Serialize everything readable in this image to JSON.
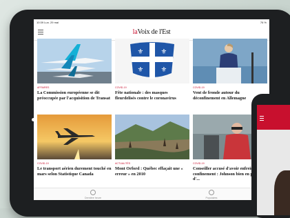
{
  "status": {
    "time": "10:39  Lun. 29 mai",
    "battery": "76 %"
  },
  "header": {
    "logo_la": "la",
    "logo_rest": "Voix de l'Est"
  },
  "articles": [
    {
      "category": "AFFAIRES",
      "title": "La Commission européenne se dit préoccupée par l'acquisition de Transat"
    },
    {
      "category": "COVID-19",
      "title": "Fête nationale : des masques fleurdelisés contre le coronavirus"
    },
    {
      "category": "COVID-19",
      "title": "Vent de fronde autour du déconfinement en Allemagne"
    },
    {
      "category": "COVID-19",
      "title": "Le transport aérien durement touché en mars selon Statistique Canada"
    },
    {
      "category": "ACTUALITÉS",
      "title": "Mont Orford : Québec effaçait une « erreur » en 2010"
    },
    {
      "category": "COVID-19",
      "title": "Conseiller accusé d'avoir enfreint le confinement : Johnson bien en peine d'..."
    }
  ],
  "bottom_tabs": [
    {
      "label": "Dernière heure"
    },
    {
      "label": "Populaires"
    }
  ],
  "colors": {
    "brand": "#c8102e",
    "device": "#1d1f21"
  }
}
